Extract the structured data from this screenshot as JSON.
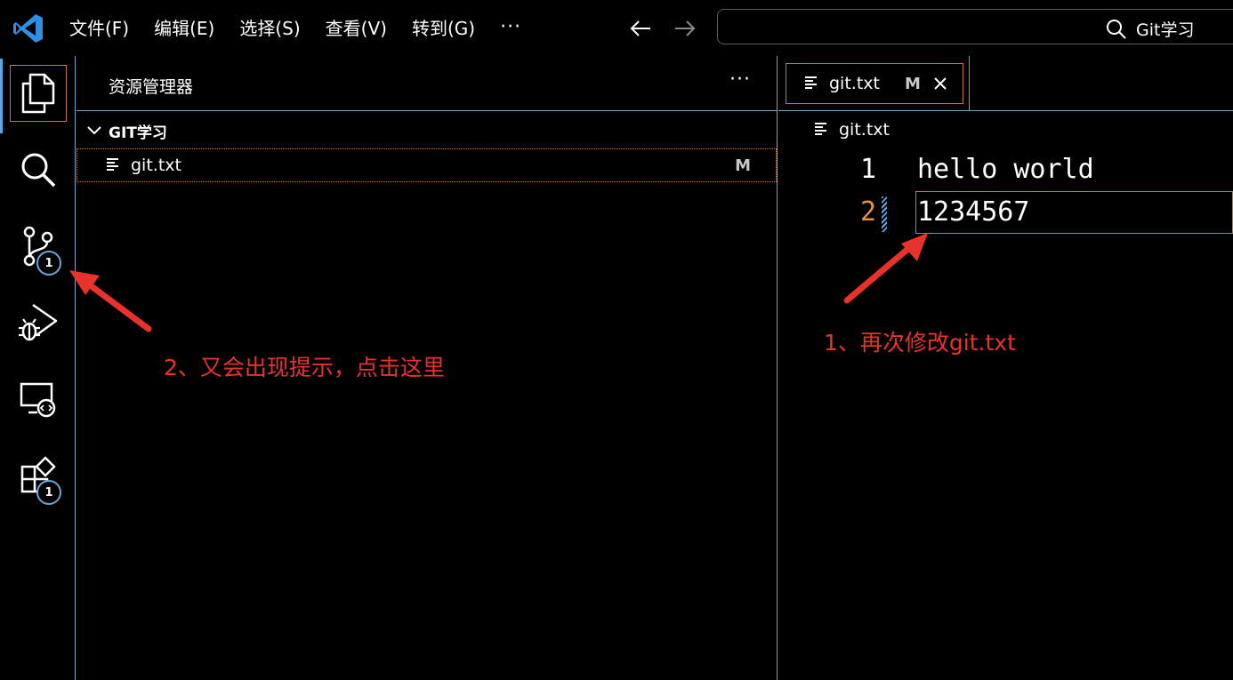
{
  "menu": {
    "items": [
      "文件(F)",
      "编辑(E)",
      "选择(S)",
      "查看(V)",
      "转到(G)"
    ],
    "more": "···"
  },
  "search": {
    "label": "Git学习"
  },
  "activity_bar": {
    "badges": {
      "source_control": "1",
      "extensions": "1"
    }
  },
  "explorer": {
    "title": "资源管理器",
    "more": "···",
    "folder": "GIT学习",
    "files": [
      {
        "name": "git.txt",
        "status": "M"
      }
    ]
  },
  "editor": {
    "tab": {
      "label": "git.txt",
      "status": "M"
    },
    "breadcrumb": "git.txt",
    "lines": [
      {
        "number": "1",
        "text": "hello world"
      },
      {
        "number": "2",
        "text": "1234567"
      }
    ]
  },
  "annotations": {
    "step1": "1、再次修改git.txt",
    "step2": "2、又会出现提示，点击这里"
  },
  "colors": {
    "annotation": "#e8322c",
    "accent_border": "#c57a44",
    "divider": "#7aa7c9",
    "modified_line_number": "#e8913a"
  }
}
